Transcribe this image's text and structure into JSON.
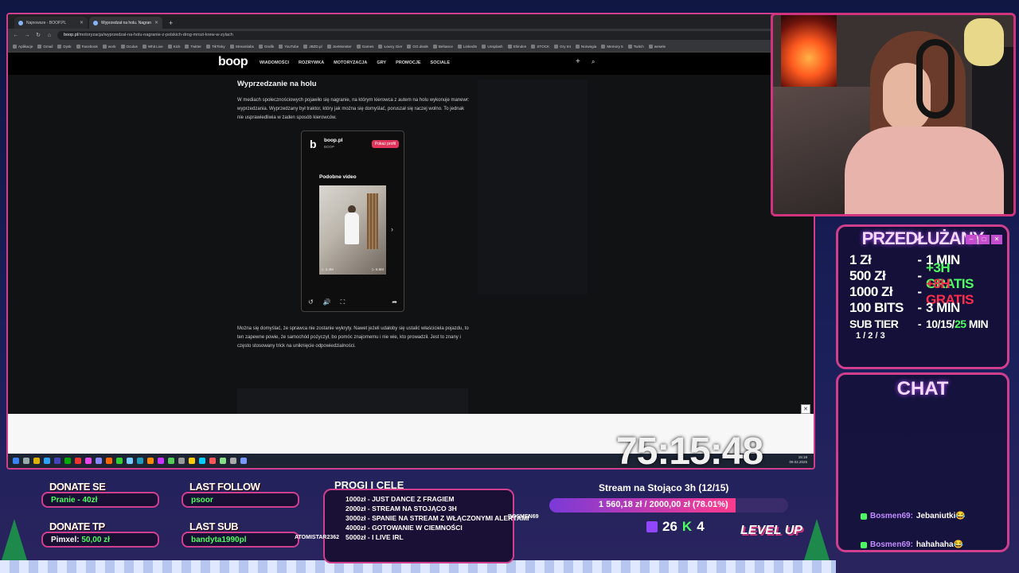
{
  "browser": {
    "tabs": [
      {
        "label": "Najnowsze - BOOP.PL",
        "active": false
      },
      {
        "label": "Wyprzedzał na holu. Nagranie",
        "active": true
      }
    ],
    "url_host": "boop.pl",
    "url_path": "/motoryzacja/wyprzedzal-na-holu-nagranie-z-polskich-drog-mrozi-krew-w-zylach",
    "bookmarks": [
      "Aplikacje",
      "Gmail",
      "Dysk",
      "Facebook",
      "work",
      "Oculus",
      "Whit Live",
      "Kick",
      "Twitter",
      "TikTinky",
      "Streamlabs",
      "Grafik",
      "YouTube",
      "JBZD.pl",
      "JoeMonster",
      "Games",
      "Łowcy Gier",
      "GG.deals",
      "Behance",
      "LinkedIn",
      "Unsplash",
      "Shinden",
      "STOCK",
      "Gry Int",
      "Norwegia",
      "Memory 5",
      "Twitch",
      "wesele"
    ]
  },
  "site": {
    "logo": "boop",
    "menu": [
      "WIADOMOŚCI",
      "ROZRYWKA",
      "MOTORYZACJA",
      "GRY",
      "PROMOCJE",
      "SOCIALE"
    ]
  },
  "article": {
    "heading": "Wyprzedzanie na holu",
    "p1": "W mediach społecznościowych pojawiło się nagranie, na którym kierowca z autem na holu wykonuje manewr: wyprzedzania. Wyprzedzany był traktor, który jak można się domyślać, poruszał się raczej wolno. To jednak nie usprawiedliwia w żaden sposób kierowców.",
    "p2": "Można się domyślać, że sprawca nie zostanie wykryty. Nawet jeżeli udałoby się ustalić właściciela pojazdu, to ten zapewne powie, że samochód pożyczył, bo pomóc znajomemu i nie wie, kto prowadził. Jest to znany i często stosowany trick na uniknięcie odpowiedzialności.",
    "embed": {
      "account": "boop.pl",
      "account_sub": "BOOP",
      "profile_button": "Pokaż profil",
      "section": "Podobne video",
      "views_left": "▷ 2.4M",
      "views_right": "▷ 6.6M"
    }
  },
  "taskbar": {
    "time": "15:18",
    "date": "09.02.2025"
  },
  "timer": "75:15:48",
  "extension": {
    "title": "PRZEDŁUŻANY",
    "rows": [
      {
        "amount": "1 Zł",
        "value": "1 MIN",
        "style": "white"
      },
      {
        "amount": "500 Zł",
        "value": "+3H GRATIS",
        "style": "green"
      },
      {
        "amount": "1000 Zł",
        "value": "+8H GRATIS",
        "style": "red"
      },
      {
        "amount": "100 BITS",
        "value": "3 MIN",
        "style": "white"
      },
      {
        "amount": "SUB TIER",
        "value": "10/15/",
        "value_highlight": "25",
        "value_tail": " MIN",
        "style": "white"
      }
    ],
    "sub_tiers": "1 / 2 / 3"
  },
  "chat": {
    "title": "CHAT",
    "messages": [
      {
        "user": "Bosmen69:",
        "text": "Jebaniutki😂"
      },
      {
        "user": "Bosmen69:",
        "text": "hahahaha😂"
      }
    ]
  },
  "overlay": {
    "donate_se_label": "DONATE SE",
    "donate_se_value": "Pranie - 40zł",
    "donate_tp_label": "DONATE TP",
    "donate_tp_name": "Pimxel:",
    "donate_tp_value": "50,00 zł",
    "last_follow_label": "LAST FOLLOW",
    "last_follow_value": "psoor",
    "last_sub_label": "LAST SUB",
    "last_sub_value": "bandyta1990pl",
    "goals_title": "PROGI I CELE",
    "goals": [
      "1000zł - JUST DANCE Z FRAGIEM",
      "2000zł - STREAM NA STOJĄCO 3H",
      "3000zł - SPANIE NA STREAM Z WŁĄCZONYMI ALERTAMI",
      "4000zł - GOTOWANIE W CIEMNOŚCI",
      "5000zł - I LIVE IRL"
    ],
    "ticker_left": "ATOMISTAR2362",
    "ticker_right": "BOSMEN69",
    "stream_goal": "Stream na Stojąco 3h (12/15)",
    "goal_progress": "1 560,18 zł / 2000,00 zł (78.01%)",
    "progress_fraction": 0.7801,
    "twitch_count": "26",
    "kick_count": "4",
    "levelup": "LEVEL UP"
  }
}
